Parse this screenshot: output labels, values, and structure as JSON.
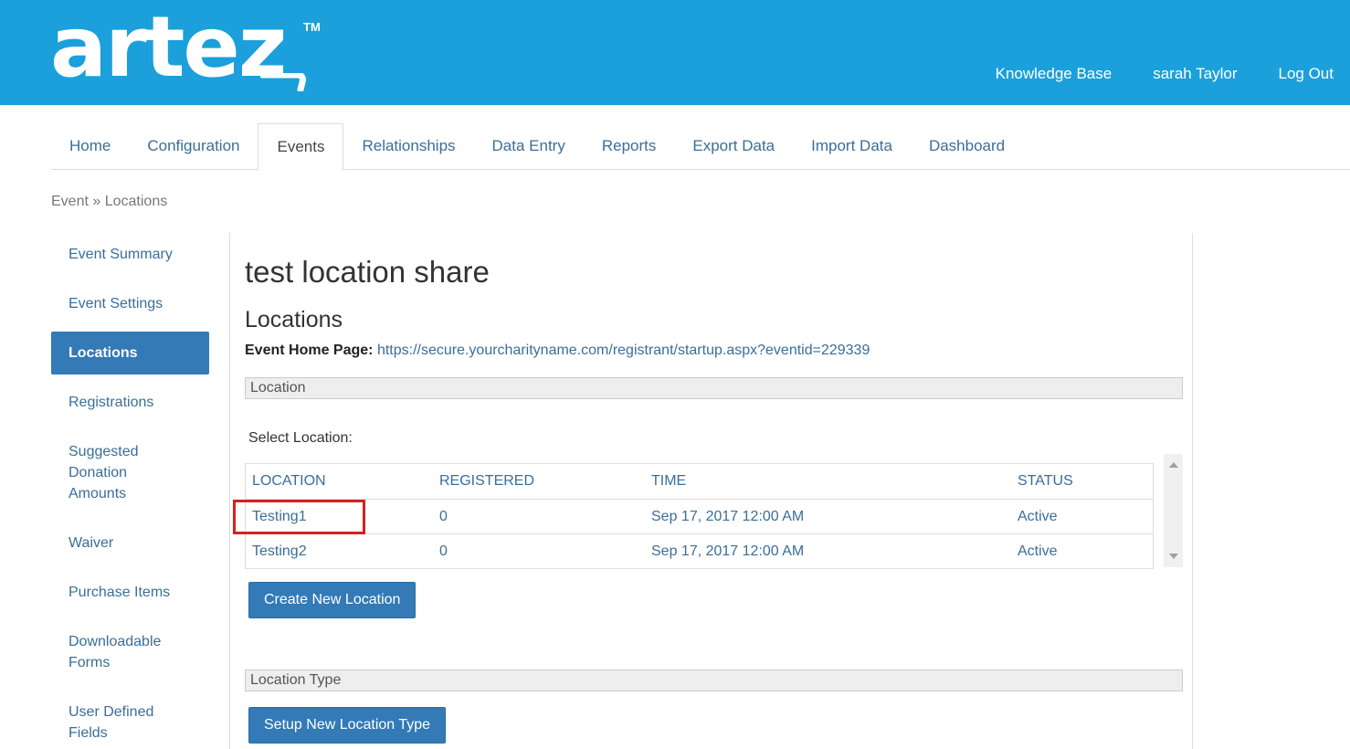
{
  "header": {
    "logo_text": "artez",
    "logo_tm": "TM",
    "links": [
      "Knowledge Base",
      "sarah Taylor",
      "Log Out"
    ]
  },
  "tabs": [
    {
      "label": "Home"
    },
    {
      "label": "Configuration"
    },
    {
      "label": "Events",
      "active": true
    },
    {
      "label": "Relationships"
    },
    {
      "label": "Data Entry"
    },
    {
      "label": "Reports"
    },
    {
      "label": "Export Data"
    },
    {
      "label": "Import Data"
    },
    {
      "label": "Dashboard"
    }
  ],
  "breadcrumb": {
    "parent": "Event",
    "separator": "»",
    "current": "Locations"
  },
  "sidebar": {
    "items": [
      "Event Summary",
      "Event Settings",
      "Locations",
      "Registrations",
      "Suggested Donation Amounts",
      "Waiver",
      "Purchase Items",
      "Downloadable Forms",
      "User Defined Fields"
    ],
    "active_index": 2
  },
  "main": {
    "page_title": "test location share",
    "section_title": "Locations",
    "home_page_label": "Event Home Page:",
    "home_page_url": "https://secure.yourcharityname.com/registrant/startup.aspx?eventid=229339",
    "location_panel": "Location",
    "select_label": "Select Location:",
    "table": {
      "columns": [
        "LOCATION",
        "REGISTERED",
        "TIME",
        "STATUS"
      ],
      "rows": [
        [
          "Testing1",
          "0",
          "Sep 17, 2017 12:00 AM",
          "Active"
        ],
        [
          "Testing2",
          "0",
          "Sep 17, 2017 12:00 AM",
          "Active"
        ]
      ]
    },
    "create_button": "Create New Location",
    "location_type_panel": "Location Type",
    "setup_button": "Setup New Location Type"
  },
  "colors": {
    "header_bg": "#1ba0db",
    "primary_button": "#337ab7",
    "link": "#3a6e9a",
    "highlight": "#d72020"
  }
}
